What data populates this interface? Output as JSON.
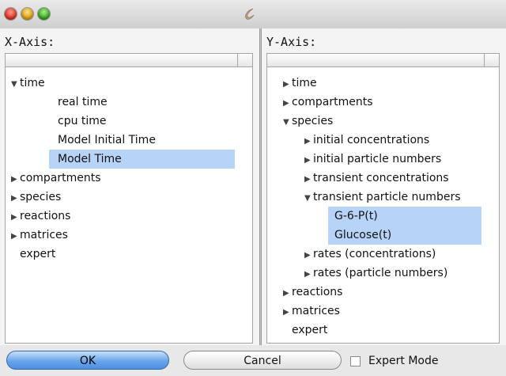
{
  "window": {
    "traffic_lights": [
      "close",
      "minimize",
      "zoom"
    ],
    "app_icon": "copasi-icon"
  },
  "x_axis": {
    "label": "X-Axis:",
    "tree": [
      {
        "text": "time",
        "expander": "expanded",
        "selected": false
      },
      {
        "text": "real time",
        "expander": "none",
        "selected": false
      },
      {
        "text": "cpu time",
        "expander": "none",
        "selected": false
      },
      {
        "text": "Model Initial Time",
        "expander": "none",
        "selected": false
      },
      {
        "text": "Model Time",
        "expander": "none",
        "selected": true
      },
      {
        "text": "compartments",
        "expander": "collapsed",
        "selected": false
      },
      {
        "text": "species",
        "expander": "collapsed",
        "selected": false
      },
      {
        "text": "reactions",
        "expander": "collapsed",
        "selected": false
      },
      {
        "text": "matrices",
        "expander": "collapsed",
        "selected": false
      },
      {
        "text": "expert",
        "expander": "none",
        "selected": false
      }
    ]
  },
  "y_axis": {
    "label": "Y-Axis:",
    "tree": [
      {
        "text": "time",
        "expander": "collapsed",
        "selected": false
      },
      {
        "text": "compartments",
        "expander": "collapsed",
        "selected": false
      },
      {
        "text": "species",
        "expander": "expanded",
        "selected": false
      },
      {
        "text": "initial concentrations",
        "expander": "collapsed",
        "selected": false
      },
      {
        "text": "initial particle numbers",
        "expander": "collapsed",
        "selected": false
      },
      {
        "text": "transient concentrations",
        "expander": "collapsed",
        "selected": false
      },
      {
        "text": "transient particle numbers",
        "expander": "expanded",
        "selected": false
      },
      {
        "text": "G-6-P(t)",
        "expander": "none",
        "selected": true
      },
      {
        "text": "Glucose(t)",
        "expander": "none",
        "selected": true
      },
      {
        "text": "rates (concentrations)",
        "expander": "collapsed",
        "selected": false
      },
      {
        "text": "rates (particle numbers)",
        "expander": "collapsed",
        "selected": false
      },
      {
        "text": "reactions",
        "expander": "collapsed",
        "selected": false
      },
      {
        "text": "matrices",
        "expander": "collapsed",
        "selected": false
      },
      {
        "text": "expert",
        "expander": "none",
        "selected": false
      }
    ]
  },
  "buttons": {
    "ok": "OK",
    "cancel": "Cancel"
  },
  "expert_mode": {
    "label": "Expert Mode",
    "checked": false
  }
}
